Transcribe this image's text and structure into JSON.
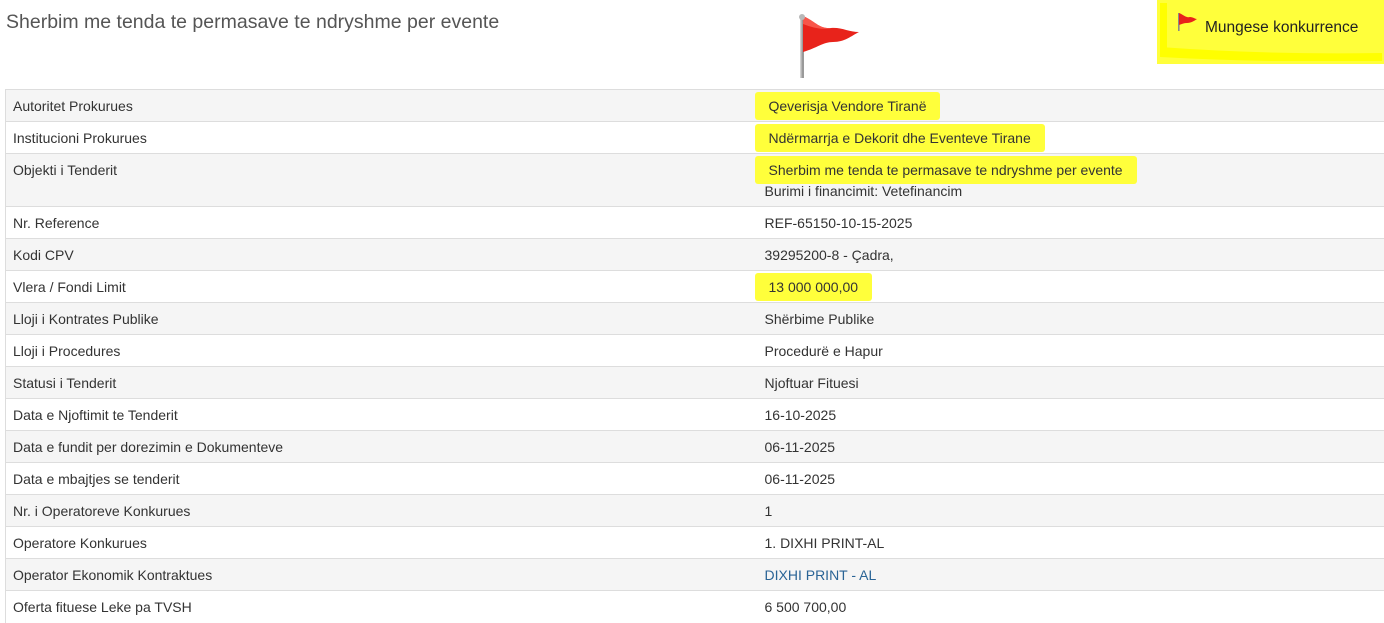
{
  "page": {
    "title": "Sherbim me tenda te permasave te ndryshme per evente"
  },
  "badge": {
    "label": "Mungese konkurrence",
    "icon": "red-flag-icon",
    "highlight_color": "#ffff00"
  },
  "colors": {
    "flag": "#e8231b",
    "highlight": "#ffff3b",
    "link": "#2a6496"
  },
  "rows": [
    {
      "label": "Autoritet Prokurues",
      "value": "Qeverisja Vendore Tiranë"
    },
    {
      "label": "Institucioni Prokurues",
      "value": "Ndërmarrja e Dekorit dhe Eventeve Tirane"
    },
    {
      "label": "Objekti i Tenderit",
      "value": "Sherbim me tenda te permasave te ndryshme per evente",
      "value2": "Burimi i financimit: Vetefinancim"
    },
    {
      "label": "Nr. Reference",
      "value": "REF-65150-10-15-2025"
    },
    {
      "label": "Kodi CPV",
      "value": "39295200-8 - Çadra,"
    },
    {
      "label": "Vlera / Fondi Limit",
      "value": "13 000 000,00"
    },
    {
      "label": "Lloji i Kontrates Publike",
      "value": "Shërbime Publike"
    },
    {
      "label": "Lloji i Procedures",
      "value": "Procedurë e Hapur"
    },
    {
      "label": "Statusi i Tenderit",
      "value": "Njoftuar Fituesi"
    },
    {
      "label": "Data e Njoftimit te Tenderit",
      "value": "16-10-2025"
    },
    {
      "label": "Data e fundit per dorezimin e Dokumenteve",
      "value": "06-11-2025"
    },
    {
      "label": "Data e mbajtjes se tenderit",
      "value": "06-11-2025"
    },
    {
      "label": "Nr. i Operatoreve Konkurues",
      "value": "1"
    },
    {
      "label": "Operatore Konkurues",
      "value": "1. DIXHI PRINT-AL"
    },
    {
      "label": "Operator Ekonomik Kontraktues",
      "value": "DIXHI PRINT - AL"
    },
    {
      "label": "Oferta fituese Leke pa TVSH",
      "value": "6 500 700,00"
    }
  ]
}
